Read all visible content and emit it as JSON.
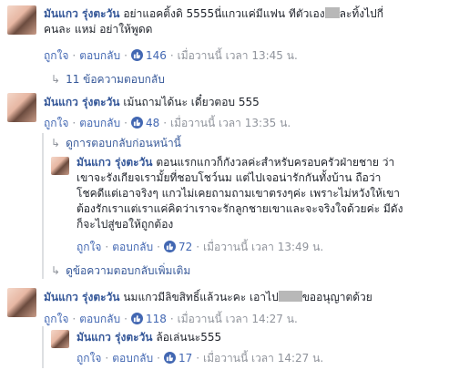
{
  "actions": {
    "like": "ถูกใจ",
    "reply": "ตอบกลับ",
    "time_prefix": "เมื่อวานนี้ เวลา"
  },
  "comments": [
    {
      "name": "มันแกว รุ่งตะวัน",
      "text_1": "อย่าแอคติ้งดิ 5555นี่แกวแค่มีแฟน ทีตัวเอง",
      "text_1b": "ละทิ้งไปกี่",
      "text_2": "คนละ แหม่ อย่าให้พูดด",
      "likes": "146",
      "time": "13:45 น."
    },
    {
      "name": "มันแกว รุ่งตะวัน",
      "text_1": "เม้นถามได้นะ เดี๋ยวตอบ 555",
      "likes": "48",
      "time": "13:35 น."
    },
    {
      "name": "มันแกว รุ่งตะวัน",
      "text_1": "ตอนแรกแกวก็กังวลค่ะสำหรับครอบครัวฝ่ายชาย ว่า",
      "text_2": "เขาจะรังเกียจเรามั้ยที่ชอบโชว์นม แต่ไปเจอน่ารักกันทั้งบ้าน ถือว่า",
      "text_3": "โชคดีแต่เอาจริงๆ แกวไม่เคยถามถามเขาตรงๆค่ะ เพราะไม่หวังให้เขา",
      "text_4": "ต้องรักเราแต่เราแค่คิดว่าเราจะรักลูกชายเขาและจะจริงใจด้วยค่ะ มีดัง",
      "text_5": "ก็จะไปสู่ขอให้ถูกต้อง",
      "likes": "72",
      "time": "13:49 น."
    },
    {
      "name": "มันแกว รุ่งตะวัน",
      "text_1": "นมแกวมีลิขสิทธิ์แล้วนะคะ เอาไป",
      "text_1b": "ขออนุญาตด้วย",
      "likes": "118",
      "time": "14:27 น."
    },
    {
      "name": "มันแกว รุ่งตะวัน",
      "text_1": "ล้อเล่นนะ555",
      "likes": "17",
      "time": "14:27 น."
    }
  ],
  "links": {
    "replies_11": "11 ข้อความตอบกลับ",
    "previous_replies": "ดูการตอบกลับก่อนหน้านี้",
    "more_replies": "ดูข้อความตอบกลับเพิ่มเติม"
  },
  "colors": {
    "link": "#365899",
    "like": "#4267b2",
    "meta": "#90949c"
  }
}
